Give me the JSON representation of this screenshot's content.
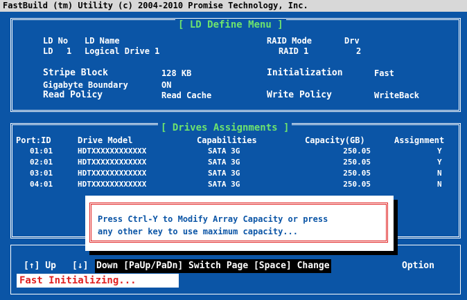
{
  "title_bar": "FastBuild (tm) Utility (c) 2004-2010 Promise Technology, Inc.",
  "ld_define": {
    "title": "[ LD Define Menu ]",
    "ld_no_label": "LD No",
    "ld_name_label": "LD Name",
    "raid_mode_label": "RAID Mode",
    "drv_label": "Drv",
    "ld_prefix": "LD",
    "ld_no": "1",
    "ld_name": "Logical Drive 1",
    "raid_mode": "RAID 1",
    "drv": "2",
    "stripe_block_label": "Stripe Block",
    "stripe_block": "128 KB",
    "initialization_label": "Initialization",
    "initialization": "Fast",
    "gigabyte_boundary_label": "Gigabyte Boundary",
    "gigabyte_boundary": "ON",
    "read_policy_label": "Read Policy",
    "read_policy": "Read Cache",
    "write_policy_label": "Write Policy",
    "write_policy": "WriteBack"
  },
  "drives": {
    "title": "[ Drives Assignments ]",
    "headers": {
      "port": "Port:ID",
      "model": "Drive Model",
      "capabilities": "Capabilities",
      "capacity": "Capacity(GB)",
      "assignment": "Assignment"
    },
    "rows": [
      {
        "port": "01:01",
        "model": "HDTXXXXXXXXXXXX",
        "capabilities": "SATA 3G",
        "capacity": "250.05",
        "assignment": "Y"
      },
      {
        "port": "02:01",
        "model": "HDTXXXXXXXXXXXX",
        "capabilities": "SATA 3G",
        "capacity": "250.05",
        "assignment": "Y"
      },
      {
        "port": "03:01",
        "model": "HDTXXXXXXXXXXXX",
        "capabilities": "SATA 3G",
        "capacity": "250.05",
        "assignment": "N"
      },
      {
        "port": "04:01",
        "model": "HDTXXXXXXXXXXXX",
        "capabilities": "SATA 3G",
        "capacity": "250.05",
        "assignment": "N"
      }
    ]
  },
  "popup": {
    "line1": "Press Ctrl-Y to Modify Array Capacity or press",
    "line2": "any other key to use maximum capacity..."
  },
  "help": {
    "up": "[↑] Up",
    "down_key": "[↓]",
    "down_rest": "Down [PaUp/PaDn] Switch Page [Space] Change",
    "option": "Option"
  },
  "status": "Fast Initializing..."
}
